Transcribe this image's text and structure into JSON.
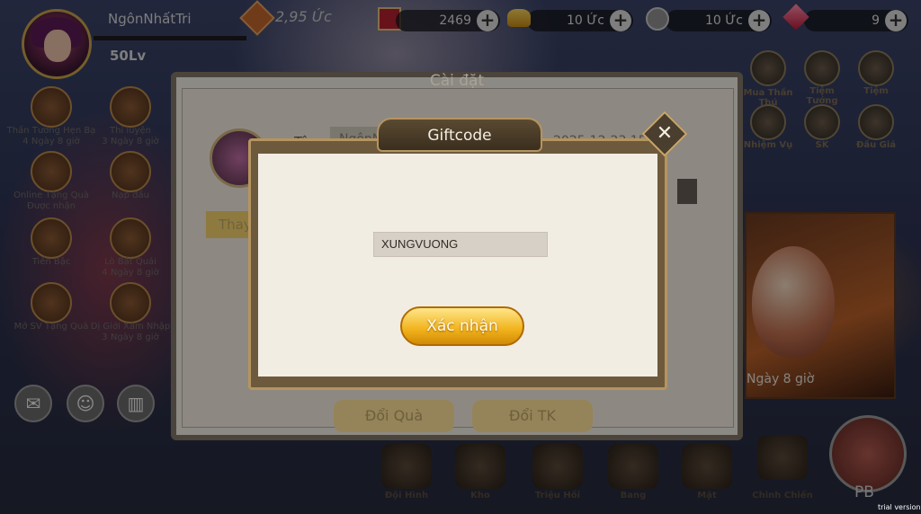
{
  "player": {
    "name": "NgônNhấtTri",
    "level": "50Lv",
    "power": "2,95 Ức"
  },
  "currencies": [
    {
      "id": "vip",
      "value": "2469",
      "icon": "red-flag-icon"
    },
    {
      "id": "gold",
      "value": "10 Ức",
      "icon": "gold-ingot-icon"
    },
    {
      "id": "silver",
      "value": "10 Ức",
      "icon": "silver-coin-icon"
    },
    {
      "id": "gem",
      "value": "9",
      "icon": "ruby-gem-icon"
    }
  ],
  "left_events": [
    {
      "label": "Thần Tướng Hẹn Bạ",
      "sub": "4 Ngày 8 giờ"
    },
    {
      "label": "Thí luyện",
      "sub": "3 Ngày 8 giờ"
    },
    {
      "label": "Online Tặng Quà",
      "sub": "Được nhận"
    },
    {
      "label": "Nạp đầu",
      "sub": ""
    },
    {
      "label": "Tiến Bậc",
      "sub": ""
    },
    {
      "label": "Lò Bát Quái",
      "sub": "4 Ngày 8 giờ"
    },
    {
      "label": "Mở SV Tặng Quà",
      "sub": ""
    },
    {
      "label": "Dị Giới Xâm Nhập",
      "sub": "3 Ngày 8 giờ"
    }
  ],
  "right_menu": [
    {
      "label": "Mua Thần Thú"
    },
    {
      "label": "Tiệm Tướng"
    },
    {
      "label": "Tiệm"
    },
    {
      "label": "Nhiệm Vụ"
    },
    {
      "label": "SK"
    },
    {
      "label": "Đấu Giá"
    }
  ],
  "bottom_menu": [
    {
      "label": "Đội Hình"
    },
    {
      "label": "Kho"
    },
    {
      "label": "Triệu Hồi"
    },
    {
      "label": "Bang"
    },
    {
      "label": "Mặt"
    },
    {
      "label": "Chinh Chiến"
    }
  ],
  "pb_label": "PB",
  "promo_timer": "Ngày 8 giờ",
  "settings": {
    "title": "Cài đặt",
    "name_label": "Tên",
    "name_value": "NgônNhấtT",
    "datetime": "2025-12-23 15:43",
    "change_button": "Thay",
    "gift_button": "Đổi Quà",
    "switch_account_button": "Đổi TK"
  },
  "giftcode": {
    "title": "Giftcode",
    "code_value": "XUNGVUONG",
    "confirm_button": "Xác nhận",
    "close_symbol": "✕"
  },
  "watermark": "trial version"
}
